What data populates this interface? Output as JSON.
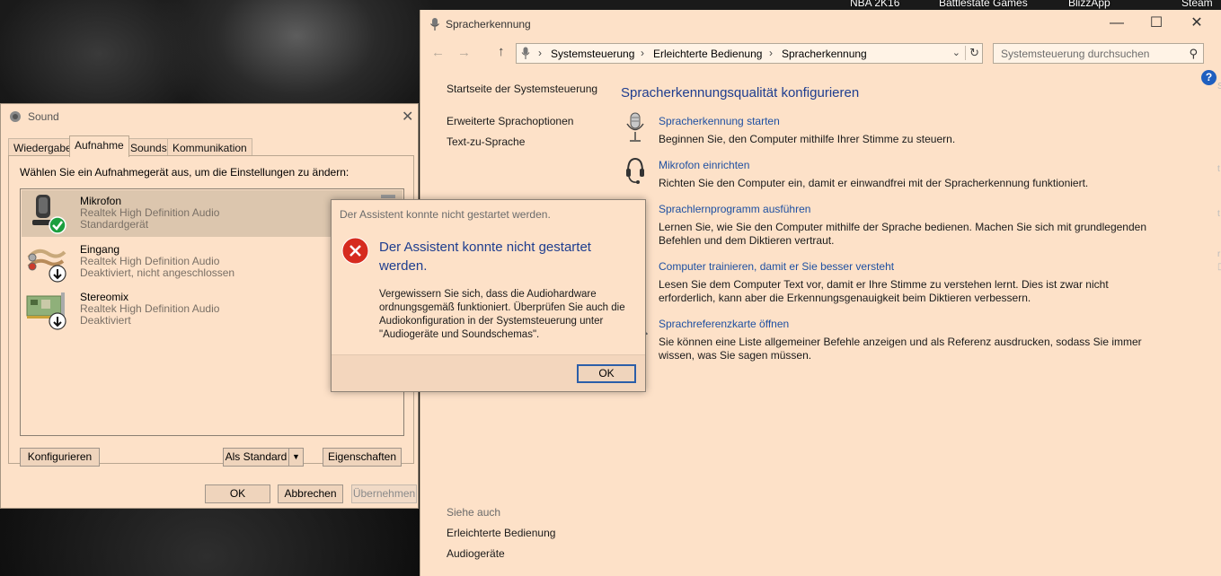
{
  "desktop": {
    "labels": [
      "NBA 2K16",
      "Battlestate Games",
      "BlizzApp",
      "Steam"
    ],
    "help_glyph": "?"
  },
  "control_panel": {
    "title": "Spracherkennung",
    "window_controls": {
      "minimize": "—",
      "maximize": "☐",
      "close": "✕"
    },
    "breadcrumb": [
      "Systemsteuerung",
      "Erleichterte Bedienung",
      "Spracherkennung"
    ],
    "search_placeholder": "Systemsteuerung durchsuchen",
    "left_nav": {
      "home": "Startseite der Systemsteuerung",
      "links": [
        "Erweiterte Sprachoptionen",
        "Text-zu-Sprache"
      ],
      "see_also_label": "Siehe auch",
      "see_also": [
        "Erleichterte Bedienung",
        "Audiogeräte"
      ]
    },
    "heading": "Spracherkennungsqualität konfigurieren",
    "tasks": [
      {
        "icon": "microphone-icon",
        "link": "Spracherkennung starten",
        "desc": "Beginnen Sie, den Computer mithilfe Ihrer Stimme zu steuern."
      },
      {
        "icon": "headset-icon",
        "link": "Mikrofon einrichten",
        "desc": "Richten Sie den Computer ein, damit er einwandfrei mit der Spracherkennung funktioniert."
      },
      {
        "icon": "tutorial-icon",
        "link": "Sprachlernprogramm ausführen",
        "desc": "Lernen Sie, wie Sie den Computer mithilfe der Sprache bedienen. Machen Sie sich mit grundlegenden Befehlen und dem Diktieren vertraut."
      },
      {
        "icon": "training-icon",
        "link": "Computer trainieren, damit er Sie besser versteht",
        "desc": "Lesen Sie dem Computer Text vor, damit er Ihre Stimme zu verstehen lernt. Dies ist zwar nicht erforderlich, kann aber die Erkennungsgenauigkeit beim Diktieren verbessern."
      },
      {
        "icon": "reference-card-icon",
        "link": "Sprachreferenzkarte öffnen",
        "desc": "Sie können eine Liste allgemeiner Befehle anzeigen und als Referenz ausdrucken, sodass Sie immer wissen, was Sie sagen müssen."
      }
    ]
  },
  "sound_dialog": {
    "title": "Sound",
    "tabs": [
      "Wiedergabe",
      "Aufnahme",
      "Sounds",
      "Kommunikation"
    ],
    "active_tab": "Aufnahme",
    "instruction": "Wählen Sie ein Aufnahmegerät aus, um die Einstellungen zu ändern:",
    "devices": [
      {
        "name": "Mikrofon",
        "driver": "Realtek High Definition Audio",
        "status": "Standardgerät",
        "badge": "check",
        "selected": true
      },
      {
        "name": "Eingang",
        "driver": "Realtek High Definition Audio",
        "status": "Deaktiviert, nicht angeschlossen",
        "badge": "down-arrow",
        "selected": false
      },
      {
        "name": "Stereomix",
        "driver": "Realtek High Definition Audio",
        "status": "Deaktiviert",
        "badge": "down-arrow",
        "selected": false
      }
    ],
    "buttons": {
      "configure": "Konfigurieren",
      "set_default": "Als Standard",
      "properties": "Eigenschaften",
      "ok": "OK",
      "cancel": "Abbrechen",
      "apply": "Übernehmen"
    }
  },
  "error_dialog": {
    "title": "Der Assistent konnte nicht gestartet werden.",
    "heading": "Der Assistent konnte nicht gestartet werden.",
    "body": "Vergewissern Sie sich, dass die Audiohardware ordnungsgemäß funktioniert. Überprüfen Sie auch die Audiokonfiguration in der Systemsteuerung unter \"Audiogeräte und Soundschemas\".",
    "ok_label": "OK"
  },
  "colors": {
    "window_bg": "#fde1c8",
    "link": "#1e50a2",
    "heading": "#1e3d8f",
    "error_red": "#d62b1f",
    "check_green": "#1b9e3e"
  }
}
